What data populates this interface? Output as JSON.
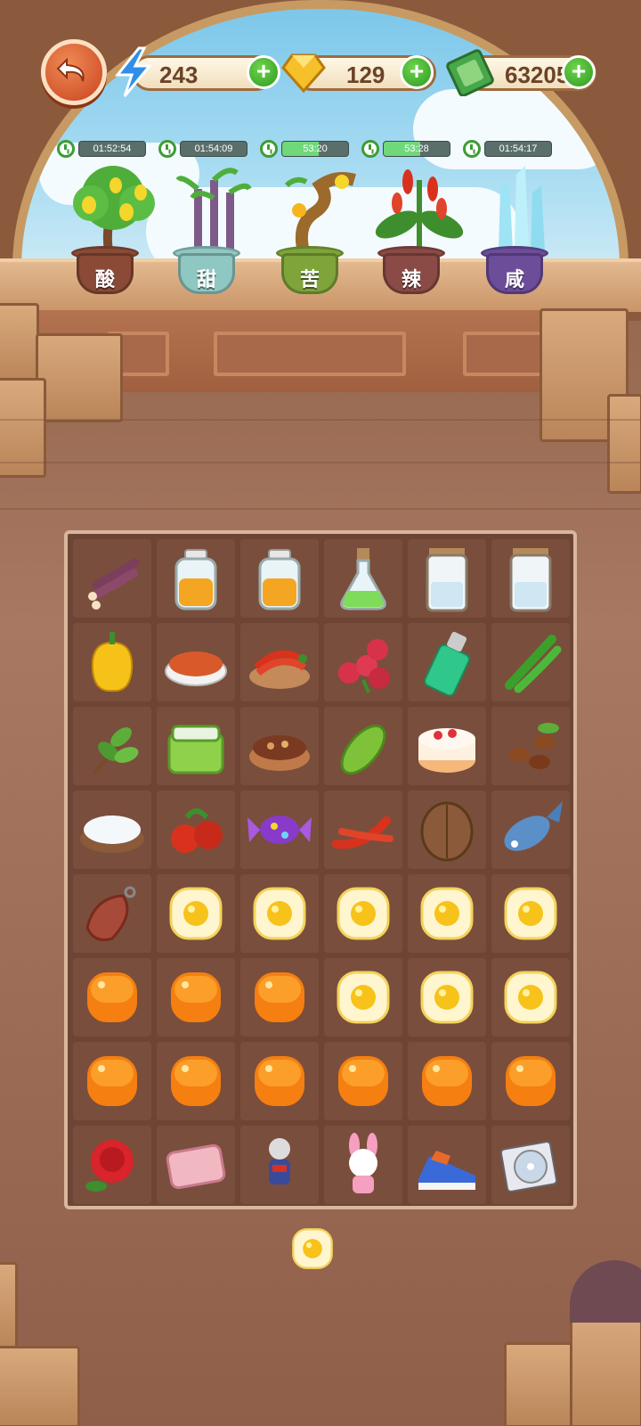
{
  "resources": {
    "energy": "243",
    "gems": "129",
    "cash": "63205",
    "plus": "+"
  },
  "timers": [
    {
      "text": "01:52:54",
      "fill": 0.0
    },
    {
      "text": "01:54:09",
      "fill": 0.0
    },
    {
      "text": "53:20",
      "fill": 0.55
    },
    {
      "text": "53:28",
      "fill": 0.55
    },
    {
      "text": "01:54:17",
      "fill": 0.0
    }
  ],
  "plants": [
    {
      "flavor": "酸",
      "icon": "lemon-tree-icon",
      "pot_color": "#8a4a36"
    },
    {
      "flavor": "甜",
      "icon": "sugarcane-plant-icon",
      "pot_color": "#8fc7c2"
    },
    {
      "flavor": "苦",
      "icon": "bitter-tree-icon",
      "pot_color": "#7ea43a"
    },
    {
      "flavor": "辣",
      "icon": "chili-plant-icon",
      "pot_color": "#8a4a45"
    },
    {
      "flavor": "咸",
      "icon": "salt-crystal-icon",
      "pot_color": "#6c4d9a"
    }
  ],
  "board": [
    [
      "sugarcane",
      "orange-jar",
      "orange-jar",
      "green-potion",
      "salt-jar",
      "salt-jar"
    ],
    [
      "yellow-pepper",
      "chili-powder",
      "chili-bowl",
      "lychee",
      "green-lighter",
      "green-chili"
    ],
    [
      "tea-leaves",
      "lunch-box",
      "spice-bowl",
      "bitter-melon",
      "strawberry-cake",
      "coffee-beans"
    ],
    [
      "salt-bowl",
      "hawthorn",
      "purple-candy",
      "red-chili",
      "walnut",
      "blue-fish"
    ],
    [
      "ham",
      "egg",
      "egg",
      "egg",
      "egg",
      "egg"
    ],
    [
      "orange-orb",
      "orange-orb",
      "orange-orb",
      "egg",
      "egg",
      "egg"
    ],
    [
      "orange-orb",
      "orange-orb",
      "orange-orb",
      "orange-orb",
      "orange-orb",
      "orange-orb"
    ],
    [
      "red-rose",
      "pink-pillow",
      "hero-figure",
      "bunny-doll",
      "sneaker",
      "music-cd"
    ]
  ],
  "queue": [
    "egg"
  ]
}
